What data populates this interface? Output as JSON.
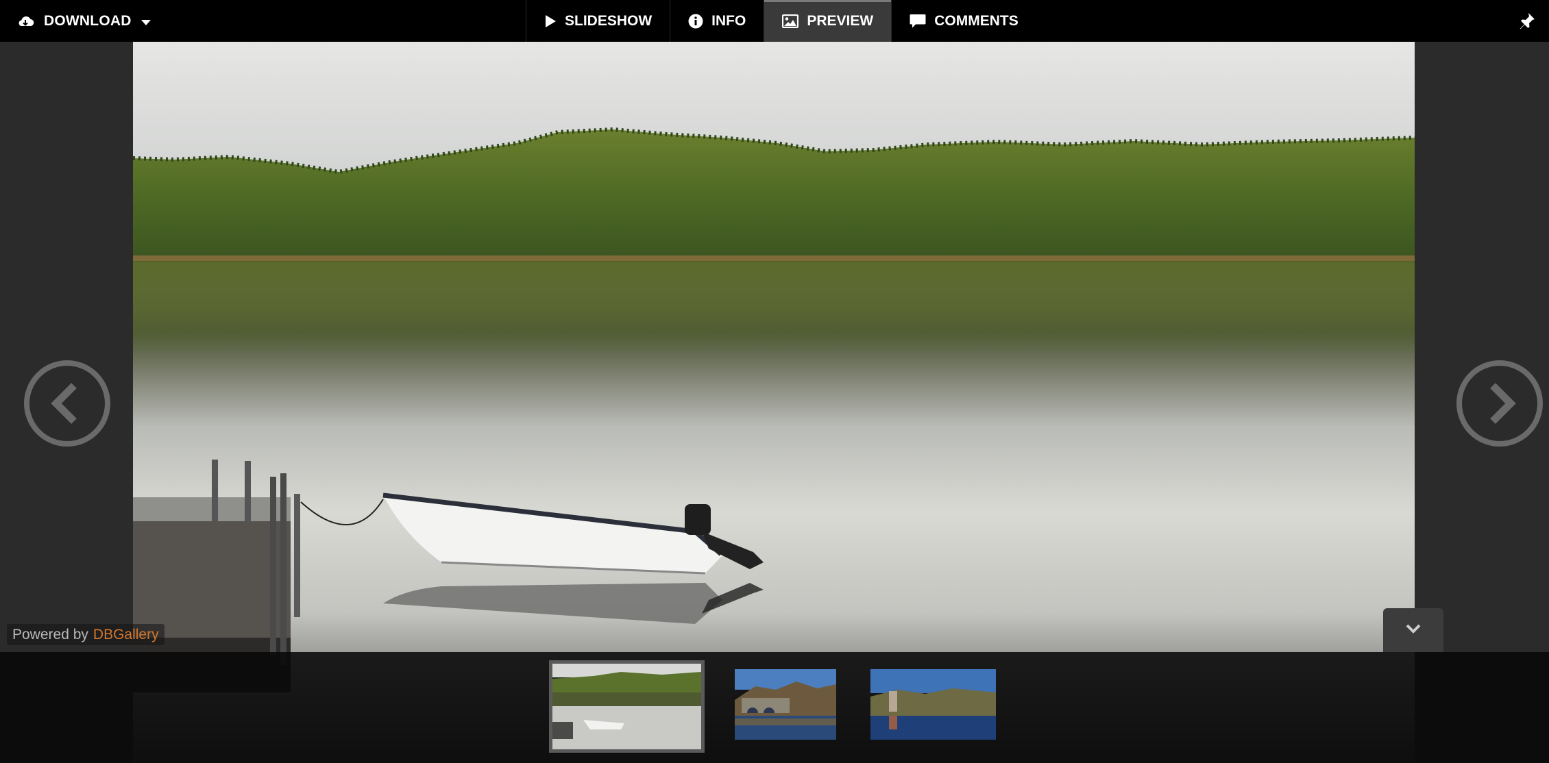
{
  "toolbar": {
    "download_label": "DOWNLOAD",
    "tabs": [
      {
        "label": "SLIDESHOW",
        "icon": "play-icon"
      },
      {
        "label": "INFO",
        "icon": "info-icon"
      },
      {
        "label": "PREVIEW",
        "icon": "image-icon",
        "active": true
      },
      {
        "label": "COMMENTS",
        "icon": "comment-icon"
      }
    ],
    "pin_icon": "pin-icon"
  },
  "viewer": {
    "image_subject": "lake-with-rowboat-and-dock",
    "prev_icon": "chevron-left-circle-icon",
    "next_icon": "chevron-right-circle-icon",
    "collapse_icon": "chevron-down-icon"
  },
  "footer": {
    "powered_by_text": "Powered by",
    "powered_by_link": "DBGallery"
  },
  "filmstrip": {
    "thumbnails": [
      {
        "subject": "lake-with-rowboat",
        "selected": true
      },
      {
        "subject": "stone-bridge-over-lake",
        "selected": false
      },
      {
        "subject": "tower-ruin-by-lake",
        "selected": false
      }
    ]
  },
  "colors": {
    "toolbar_bg": "#000000",
    "page_bg": "#2b2b2b",
    "active_tab_bg": "#3a3a3a",
    "link_accent": "#d2772e"
  }
}
